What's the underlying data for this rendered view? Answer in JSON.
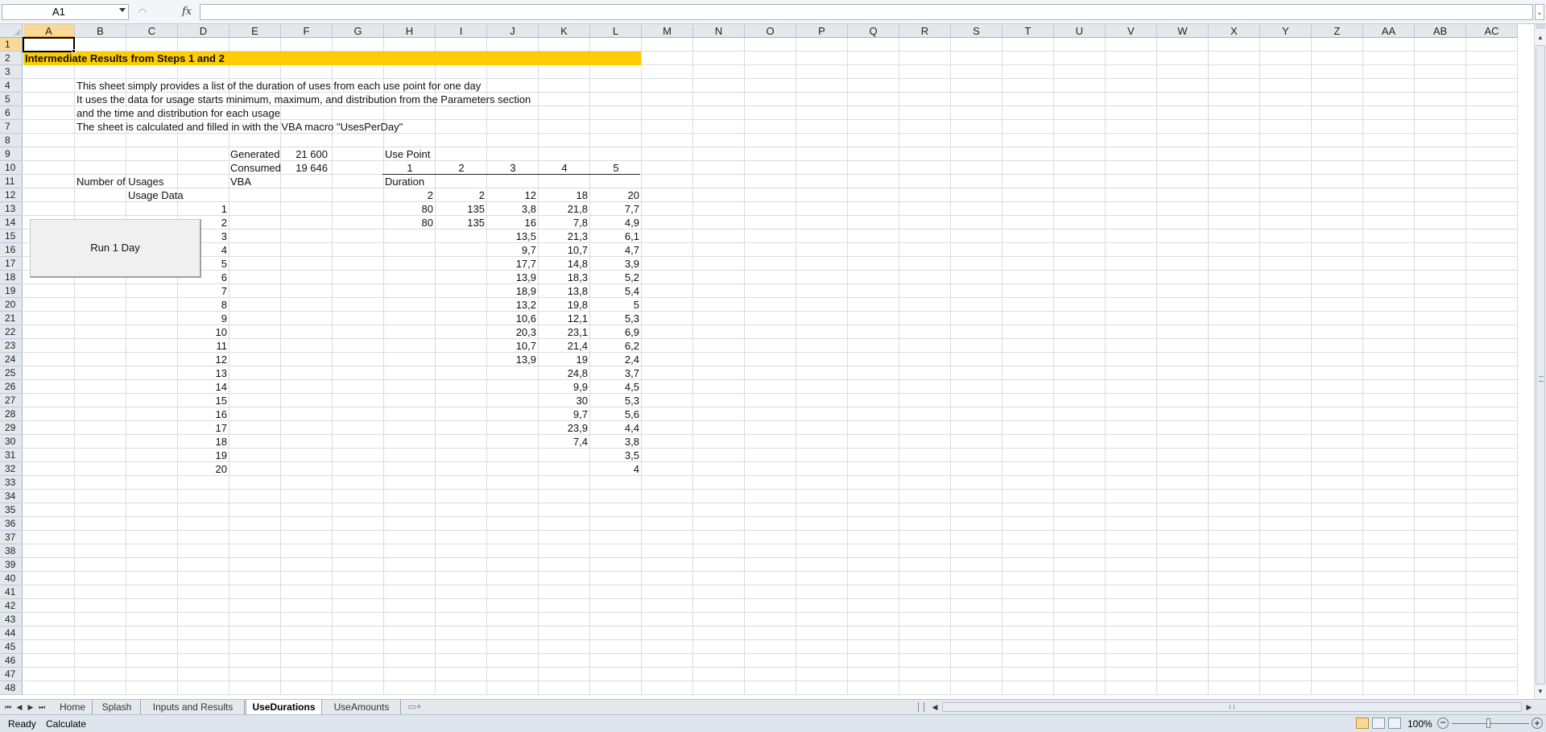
{
  "formula_bar": {
    "name_box": "A1",
    "separator": "◠",
    "fx_label": "fx",
    "formula": ""
  },
  "columns": [
    "A",
    "B",
    "C",
    "D",
    "E",
    "F",
    "G",
    "H",
    "I",
    "J",
    "K",
    "L",
    "M",
    "N",
    "O",
    "P",
    "Q",
    "R",
    "S",
    "T",
    "U",
    "V",
    "W",
    "X",
    "Y",
    "Z",
    "AA",
    "AB",
    "AC"
  ],
  "rows": [
    1,
    2,
    3,
    4,
    5,
    6,
    7,
    8,
    9,
    10,
    11,
    12,
    13,
    14,
    15,
    16,
    17,
    18,
    19,
    20,
    21,
    22,
    23,
    24,
    25,
    26,
    27,
    28,
    29,
    30,
    31,
    32,
    33,
    34,
    35,
    36,
    37,
    38,
    39,
    40,
    41,
    42,
    43,
    44,
    45,
    46,
    47,
    48
  ],
  "sheet": {
    "title": "Intermediate Results from Steps 1 and 2",
    "description": [
      "This sheet simply provides a list of the duration of uses from each use point for one day",
      "It uses the data for usage starts minimum, maximum, and distribution from the Parameters section",
      "and the time and distribution for each usage",
      "The sheet is calculated and filled in with the VBA macro \"UsesPerDay\""
    ],
    "generated_label": "Generated",
    "generated_value": "21 600",
    "consumed_label": "Consumed",
    "consumed_value": "19 646",
    "vba_label": "VBA",
    "number_of_usages_label": "Number of Usages",
    "usage_data_label": "Usage Data",
    "use_point_label": "Use Point",
    "duration_label": "Duration",
    "use_points": [
      "1",
      "2",
      "3",
      "4",
      "5"
    ],
    "row_index": [
      "1",
      "2",
      "3",
      "4",
      "5",
      "6",
      "7",
      "8",
      "9",
      "10",
      "11",
      "12",
      "13",
      "14",
      "15",
      "16",
      "17",
      "18",
      "19",
      "20"
    ],
    "number_of_usages": [
      "2",
      "2",
      "12",
      "18",
      "20"
    ],
    "durations": [
      [
        "80",
        "135",
        "3,8",
        "21,8",
        "7,7"
      ],
      [
        "80",
        "135",
        "16",
        "7,8",
        "4,9"
      ],
      [
        "",
        "",
        "13,5",
        "21,3",
        "6,1"
      ],
      [
        "",
        "",
        "9,7",
        "10,7",
        "4,7"
      ],
      [
        "",
        "",
        "17,7",
        "14,8",
        "3,9"
      ],
      [
        "",
        "",
        "13,9",
        "18,3",
        "5,2"
      ],
      [
        "",
        "",
        "18,9",
        "13,8",
        "5,4"
      ],
      [
        "",
        "",
        "13,2",
        "19,8",
        "5"
      ],
      [
        "",
        "",
        "10,6",
        "12,1",
        "5,3"
      ],
      [
        "",
        "",
        "20,3",
        "23,1",
        "6,9"
      ],
      [
        "",
        "",
        "10,7",
        "21,4",
        "6,2"
      ],
      [
        "",
        "",
        "13,9",
        "19",
        "2,4"
      ],
      [
        "",
        "",
        "",
        "24,8",
        "3,7"
      ],
      [
        "",
        "",
        "",
        "9,9",
        "4,5"
      ],
      [
        "",
        "",
        "",
        "30",
        "5,3"
      ],
      [
        "",
        "",
        "",
        "9,7",
        "5,6"
      ],
      [
        "",
        "",
        "",
        "23,9",
        "4,4"
      ],
      [
        "",
        "",
        "",
        "7,4",
        "3,8"
      ],
      [
        "",
        "",
        "",
        "",
        "3,5"
      ],
      [
        "",
        "",
        "",
        "",
        "4"
      ]
    ],
    "run_button_label": "Run 1 Day"
  },
  "tabs": {
    "items": [
      "Home",
      "Splash",
      "Inputs and Results",
      "UseDurations",
      "UseAmounts"
    ],
    "active": "UseDurations"
  },
  "status": {
    "ready": "Ready",
    "calculate": "Calculate",
    "zoom": "100%"
  },
  "colors": {
    "title_band": "#ffcc00",
    "active_header": "#f9d99a"
  }
}
